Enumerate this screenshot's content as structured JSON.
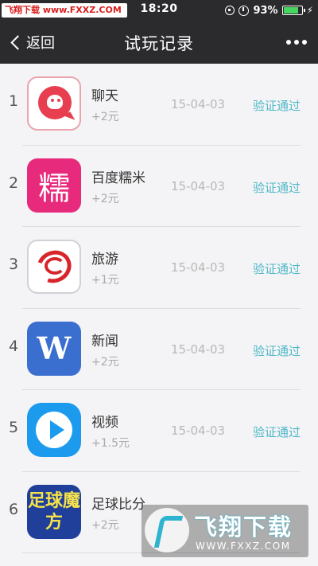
{
  "status_bar": {
    "watermark": "飞翔下载 www.FXXZ.COM",
    "time": "18:20",
    "battery_percent_label": "93%",
    "battery_level": 0.93,
    "icons": [
      "rotation-lock-icon",
      "alarm-icon",
      "battery-icon",
      "charging-icon"
    ],
    "charging_glyph": "⚡"
  },
  "navbar": {
    "back_label": "返回",
    "title": "试玩记录",
    "more_icon": "more-dots-icon"
  },
  "records": [
    {
      "index": "1",
      "name": "聊天",
      "reward": "+2元",
      "date": "15-04-03",
      "status": "验证通过",
      "icon": "chat-bubble-icon"
    },
    {
      "index": "2",
      "name": "百度糯米",
      "reward": "+2元",
      "date": "15-04-03",
      "status": "验证通过",
      "icon": "nuomi-icon",
      "icon_text": "糯"
    },
    {
      "index": "3",
      "name": "旅游",
      "reward": "+1元",
      "date": "15-04-03",
      "status": "验证通过",
      "icon": "travel-swirl-icon"
    },
    {
      "index": "4",
      "name": "新闻",
      "reward": "+2元",
      "date": "15-04-03",
      "status": "验证通过",
      "icon": "news-w-icon",
      "icon_text": "W"
    },
    {
      "index": "5",
      "name": "视频",
      "reward": "+1.5元",
      "date": "15-04-03",
      "status": "验证通过",
      "icon": "video-play-icon"
    },
    {
      "index": "6",
      "name": "足球比分",
      "reward": "+2元",
      "date": "",
      "status": "",
      "icon": "football-magic-icon",
      "icon_text": "足球魔方"
    }
  ],
  "bottom_watermark": {
    "title": "飞翔下载",
    "url": "WWW.FXXZ.COM"
  },
  "colors": {
    "bar_bg": "#2b2b2e",
    "list_bg": "#f4f4f6",
    "status_ok": "#4fb8c8",
    "battery_fill": "#48d560"
  }
}
